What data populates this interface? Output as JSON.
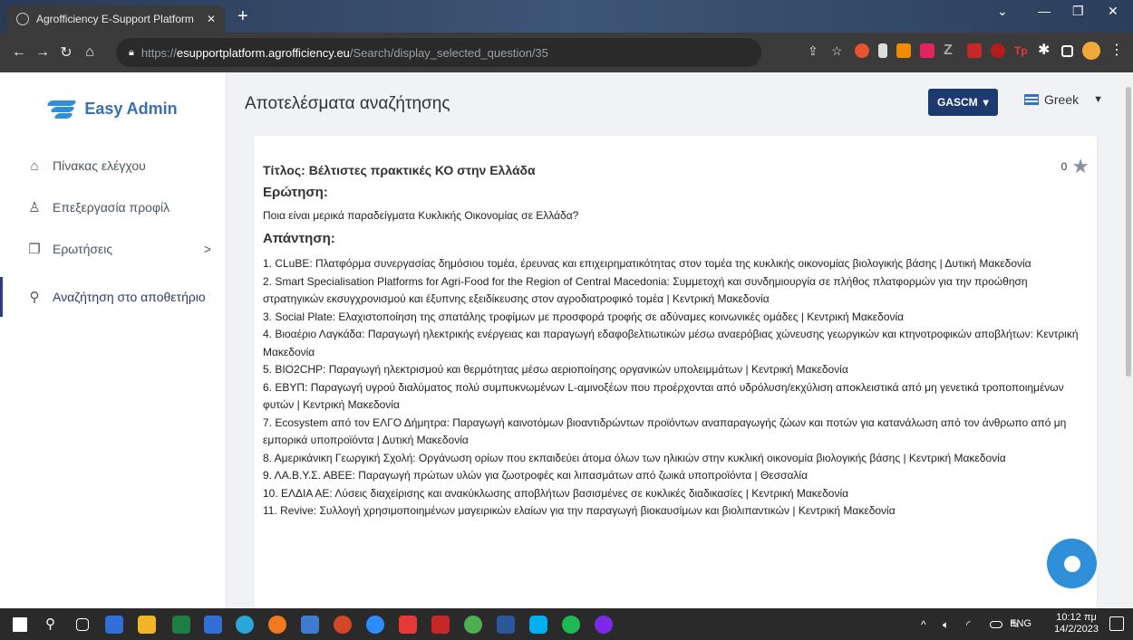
{
  "browser": {
    "tab_title": "Agrofficiency E-Support Platform",
    "tab_close": "✕",
    "new_tab": "+",
    "url_scheme": "https://",
    "url_host": "esupportplatform.agrofficiency.eu",
    "url_path": "/Search/display_selected_question/35"
  },
  "sidebar": {
    "brand": "Easy Admin",
    "items": [
      {
        "label": "Πίνακας ελέγχου",
        "icon": "home-icon"
      },
      {
        "label": "Επεξεργασία προφίλ",
        "icon": "user-icon"
      },
      {
        "label": "Ερωτήσεις",
        "icon": "questions-icon",
        "chevron": ">"
      },
      {
        "label": "Αναζήτηση στο αποθετήριο",
        "icon": "search-icon",
        "active": true
      }
    ]
  },
  "header": {
    "title": "Αποτελέσματα αναζήτησης",
    "org_button": "GASCM",
    "language": "Greek"
  },
  "question": {
    "title": "Τίτλος: Βέλτιστες πρακτικές ΚΟ στην Ελλάδα",
    "rating": "0",
    "question_heading": "Ερώτηση:",
    "question_text": "Ποια είναι μερικά παραδείγματα Κυκλικής Οικονομίας σε Ελλάδα?",
    "answer_heading": "Απάντηση:",
    "answers": [
      "1.  CLuBE: Πλατφόρμα συνεργασίας δημόσιου τομέα, έρευνας και επιχειρηματικότητας στον τομέα της κυκλικής οικονομίας βιολογικής βάσης | Δυτική Μακεδονία",
      "2.  Smart Specialisation Platforms for Agri-Food for the Region of Central Macedonia: Συμμετοχή και συνδημιουργία σε πλήθος πλατφορμών για την προώθηση στρατηγικών εκσυγχρονισμού και έξυπνης εξειδίκευσης στον αγροδιατροφικό τομέα | Κεντρική Μακεδονία",
      "3.  Social Plate: Ελαχιστοποίηση της σπατάλης τροφίμων με προσφορά τροφής σε αδύναμες κοινωνικές ομάδες | Κεντρική Μακεδονία",
      "4.  Βιοαέριο Λαγκάδα: Παραγωγή ηλεκτρικής ενέργειας και παραγωγή εδαφοβελτιωτικών μέσω αναερόβιας χώνευσης γεωργικών και κτηνοτροφικών αποβλήτων: Κεντρική Μακεδονία",
      "5.  BIO2CHP: Παραγωγή ηλεκτρισμού και θερμότητας μέσω αεριοποίησης οργανικών υπολειμμάτων | Κεντρική Μακεδονία",
      "6.  ΕΒΥΠ: Παραγωγή υγρού διαλύματος πολύ συμπυκνωμένων L-αμινοξέων που προέρχονται από υδρόλυση/εκχύλιση αποκλειστικά από μη γενετικά τροποποιημένων φυτών | Κεντρική Μακεδονία",
      "7.  Ecosystem από τον ΕΛΓΟ Δήμητρα: Παραγωγή καινοτόμων βιοαντιδρώντων προϊόντων αναπαραγωγής ζώων και ποτών για κατανάλωση από τον άνθρωπο από μη εμπορικά υποπροϊόντα | Δυτική Μακεδονία",
      "8.  Αμερικάνικη Γεωργική Σχολή: Οργάνωση ορίων που εκπαιδεύει άτομα όλων των ηλικιών στην κυκλική οικονομία βιολογικής βάσης | Κεντρική Μακεδονία",
      "9.  ΛΑ.Β.Υ.Σ. ΑΒΕΕ: Παραγωγή πρώτων υλών για ζωοτροφές και λιπασμάτων από ζωικά υποπροϊόντα | Θεσσαλία",
      "10.  ΕΛΔΙΑ ΑΕ: Λύσεις διαχείρισης και ανακύκλωσης αποβλήτων βασισμένες σε κυκλικές διαδικασίες | Κεντρική Μακεδονία",
      "11.  Revive: Συλλογή χρησιμοποιημένων μαγειρικών ελαίων για την παραγωγή βιοκαυσίμων και βιολιπαντικών | Κεντρική Μακεδονία"
    ]
  },
  "taskbar": {
    "language": "ENG",
    "time": "10:12 πμ",
    "date": "14/2/2023"
  },
  "colors": {
    "accent": "#1c3a6d",
    "brand": "#3a6fb0",
    "chat": "#2f8fd8"
  }
}
